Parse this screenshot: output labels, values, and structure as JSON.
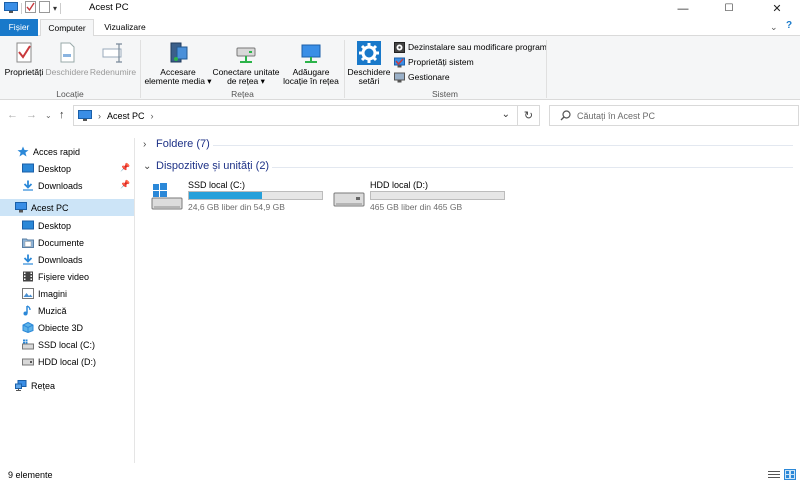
{
  "window": {
    "title": "Acest PC",
    "minimize": "—",
    "maximize": "☐",
    "close": "✕"
  },
  "tabs": {
    "file": "Fișier",
    "computer": "Computer",
    "view": "Vizualizare"
  },
  "ribbon": {
    "location": {
      "label": "Locație",
      "properties": "Proprietăți",
      "open": "Deschidere",
      "rename": "Redenumire"
    },
    "network": {
      "label": "Rețea",
      "media_line1": "Accesare",
      "media_line2": "elemente media",
      "map_line1": "Conectare unitate",
      "map_line2": "de rețea",
      "add_line1": "Adăugare",
      "add_line2": "locație în rețea"
    },
    "system": {
      "label": "Sistem",
      "settings_line1": "Deschidere",
      "settings_line2": "setări",
      "uninstall": "Dezinstalare sau modificare program",
      "sys_props": "Proprietăți sistem",
      "manage": "Gestionare"
    }
  },
  "address": {
    "path": "Acest PC",
    "separator": "›"
  },
  "search": {
    "placeholder": "Căutați în Acest PC"
  },
  "nav": {
    "quick_access": "Acces rapid",
    "qa_desktop": "Desktop",
    "qa_downloads": "Downloads",
    "this_pc": "Acest PC",
    "desktop": "Desktop",
    "documents": "Documente",
    "downloads": "Downloads",
    "videos": "Fișiere video",
    "pictures": "Imagini",
    "music": "Muzică",
    "objects3d": "Obiecte 3D",
    "ssd": "SSD local (C:)",
    "hdd": "HDD local (D:)",
    "network": "Rețea"
  },
  "content": {
    "folders_header": "Foldere (7)",
    "devices_header": "Dispozitive și unități (2)",
    "drives": [
      {
        "name": "SSD local (C:)",
        "free": "24,6 GB liber din 54,9 GB",
        "used_fraction": 0.55
      },
      {
        "name": "HDD local (D:)",
        "free": "465 GB liber din 465 GB",
        "used_fraction": 0.0
      }
    ]
  },
  "status": {
    "count": "9 elemente"
  },
  "colors": {
    "accent": "#1979ca",
    "selection": "#cce4f7",
    "drive_fill": "#26a0da",
    "header_text": "#1e3287"
  }
}
